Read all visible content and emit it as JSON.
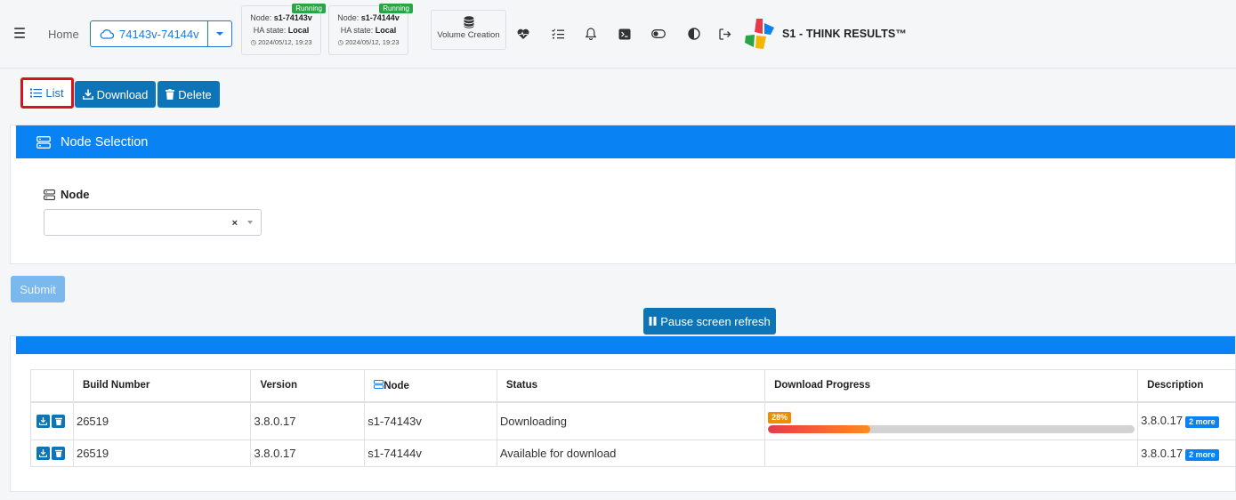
{
  "topbar": {
    "home_label": "Home",
    "cluster": "74143v-74144v",
    "nodes": [
      {
        "node_prefix": "Node: ",
        "node_name": "s1-74143v",
        "ha_prefix": "HA state: ",
        "ha_state": "Local",
        "time": "2024/05/12, 19:23",
        "badge": "Running"
      },
      {
        "node_prefix": "Node: ",
        "node_name": "s1-74144v",
        "ha_prefix": "HA state: ",
        "ha_state": "Local",
        "time": "2024/05/12, 19:23",
        "badge": "Running"
      }
    ],
    "volume_creation": "Volume Creation",
    "brand": "S1 - THINK RESULTS™"
  },
  "actions": {
    "list": "List",
    "download": "Download",
    "delete": "Delete"
  },
  "node_selection": {
    "title": "Node Selection",
    "node_label": "Node",
    "node_value": "",
    "clear": "×"
  },
  "submit": "Submit",
  "pause": "Pause screen refresh",
  "table": {
    "headers": [
      "",
      "Build Number",
      "Version",
      "Node",
      "Status",
      "Download Progress",
      "Description"
    ],
    "rows": [
      {
        "build": "26519",
        "version": "3.8.0.17",
        "node": "s1-74143v",
        "status": "Downloading",
        "progress_label": "28%",
        "progress": 0.28,
        "description": "3.8.0.17",
        "more": "2 more"
      },
      {
        "build": "26519",
        "version": "3.8.0.17",
        "node": "s1-74144v",
        "status": "Available for download",
        "progress_label": "",
        "progress": null,
        "description": "3.8.0.17",
        "more": "2 more"
      }
    ]
  },
  "colors": {
    "primary": "#0983f4",
    "button": "#0d74b8",
    "running": "#2aa545",
    "highlight": "#d6141c",
    "progress_badge": "#f08c00"
  }
}
